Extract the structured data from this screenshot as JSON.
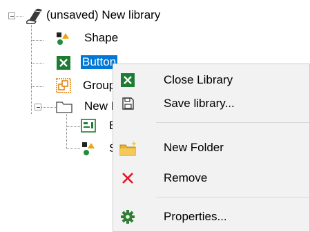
{
  "tree": {
    "root": {
      "label": "(unsaved) New library",
      "icon": "library-book-icon"
    },
    "nodes": [
      {
        "label": "Shape",
        "icon": "shape-icon",
        "selected": false
      },
      {
        "label": "Button",
        "icon": "button-icon",
        "selected": true
      },
      {
        "label": "Group",
        "icon": "group-icon",
        "selected": false
      },
      {
        "label": "New Folder",
        "icon": "folder-icon",
        "selected": false
      },
      {
        "label": "Ba",
        "icon": "text-box-icon",
        "selected": false
      },
      {
        "label": "Shape",
        "icon": "shape-icon",
        "selected": false
      }
    ]
  },
  "context_menu": {
    "items": [
      {
        "label": "Close Library",
        "icon": "close-library-icon"
      },
      {
        "label": "Save library...",
        "icon": "save-icon"
      },
      {
        "label": "New Folder",
        "icon": "new-folder-icon"
      },
      {
        "label": "Remove",
        "icon": "remove-icon"
      },
      {
        "label": "Properties...",
        "icon": "gear-icon"
      }
    ]
  },
  "colors": {
    "selection": "#0078d7",
    "menu_background": "#f2f2f2",
    "accent_green": "#2e7d32",
    "remove_red": "#e81123"
  }
}
